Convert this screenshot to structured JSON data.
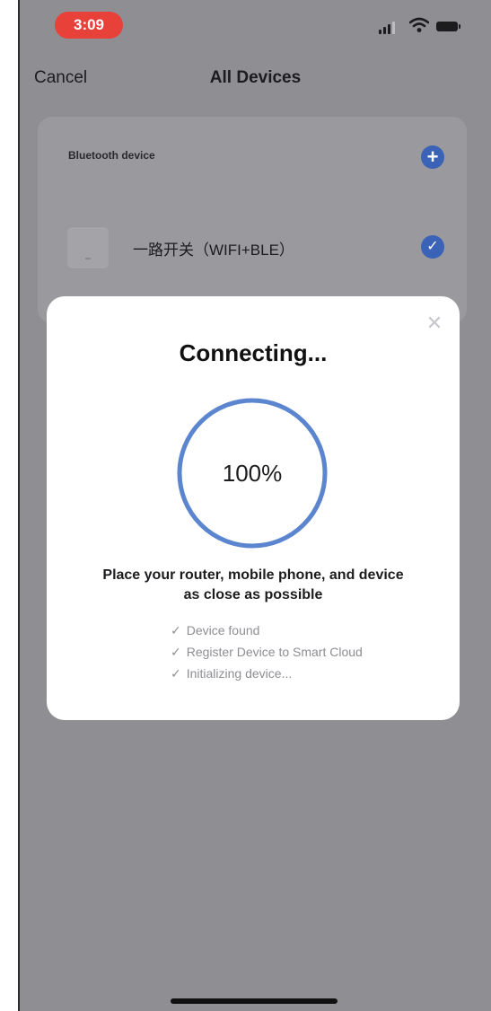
{
  "status_bar": {
    "time": "3:09"
  },
  "nav": {
    "cancel_label": "Cancel",
    "title": "All Devices"
  },
  "device_card": {
    "section_label": "Bluetooth device",
    "device_name": "一路开关（WIFI+BLE）",
    "add_icon": "plus-circle-icon",
    "selected_icon": "checkmark-circle-icon"
  },
  "modal": {
    "title": "Connecting...",
    "progress_text": "100%",
    "progress_value": 1.0,
    "hint_line1": "Place your router, mobile phone, and device",
    "hint_line2": "as close as possible",
    "steps": [
      {
        "label": "Device found"
      },
      {
        "label": "Register Device to Smart Cloud"
      },
      {
        "label": "Initializing device..."
      }
    ]
  },
  "colors": {
    "accent": "#3a63b8",
    "time_pill": "#e8413a",
    "overlay": "#8f8e93"
  }
}
